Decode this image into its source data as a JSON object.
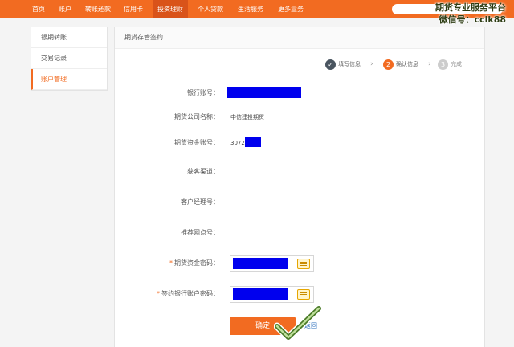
{
  "nav": {
    "items": [
      "首页",
      "账户",
      "转账还款",
      "信用卡",
      "投资理财",
      "个人贷款",
      "生活服务",
      "更多业务"
    ],
    "active_index": 4
  },
  "watermark": {
    "line1": "期货专业服务平台",
    "line2": "微信号：cclk88"
  },
  "sidebar": {
    "items": [
      {
        "label": "银期转账"
      },
      {
        "label": "交易记录"
      },
      {
        "label": "账户管理"
      }
    ]
  },
  "main": {
    "title": "期货存管签约",
    "steps": [
      {
        "num": "✓",
        "label": "填写信息",
        "state": "done"
      },
      {
        "num": "2",
        "label": "确认信息",
        "state": "current"
      },
      {
        "num": "3",
        "label": "完成",
        "state": "pending"
      }
    ],
    "fields": {
      "bank_account": {
        "label": "银行账号："
      },
      "futures_company": {
        "label": "期货公司名称：",
        "value": "中信建投期货"
      },
      "futures_fund_account": {
        "label": "期货资金账号：",
        "value": "3072"
      },
      "acquisition_channel": {
        "label": "获客渠道："
      },
      "account_manager": {
        "label": "客户经理号："
      },
      "referral_branch": {
        "label": "推荐网点号："
      },
      "futures_fund_password": {
        "label": "期货资金密码："
      },
      "bank_account_password": {
        "label": "签约银行账户密码："
      }
    },
    "required_mark": "*",
    "confirm_label": "确定",
    "back_label": "返回"
  },
  "colors": {
    "brand": "#f26b21",
    "step_done": "#4a5560",
    "step_pending": "#cccccc",
    "link": "#2a6ebb",
    "redaction": "#0000ee"
  }
}
